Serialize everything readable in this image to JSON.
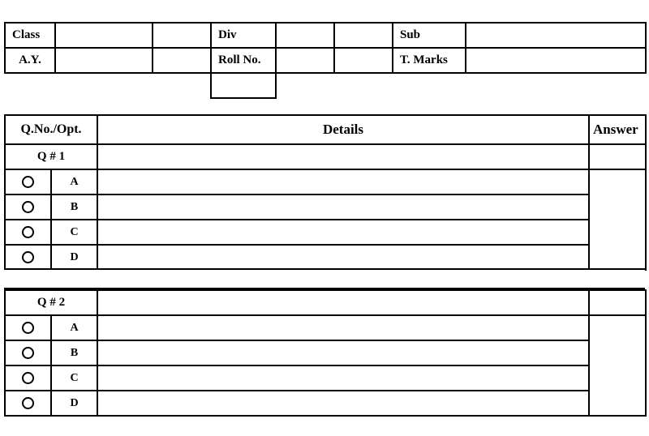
{
  "document": {
    "type": "answer-sheet-form",
    "title": "MCQ Answer Sheet Template"
  },
  "info": {
    "rows": [
      {
        "label_1": "Class",
        "value_1": "",
        "value_1b": "",
        "label_2": "Div",
        "value_2": "",
        "value_2b": "",
        "label_3": "Sub",
        "value_3": ""
      },
      {
        "label_1": "A.Y.",
        "value_1": "",
        "value_1b": "",
        "label_2": "Roll No.",
        "value_2": "",
        "value_2b": "",
        "label_3": "T. Marks",
        "value_3": ""
      }
    ],
    "third_row": {
      "cell": ""
    }
  },
  "grid": {
    "headers": {
      "qno_opt": "Q.No./Opt.",
      "details": "Details",
      "answer": "Answer"
    },
    "questions": [
      {
        "number_label": "Q # 1",
        "question_details": "",
        "answer": "",
        "options": [
          {
            "bubble": "radio-circle-icon",
            "letter": "A",
            "details": ""
          },
          {
            "bubble": "radio-circle-icon",
            "letter": "B",
            "details": ""
          },
          {
            "bubble": "radio-circle-icon",
            "letter": "C",
            "details": ""
          },
          {
            "bubble": "radio-circle-icon",
            "letter": "D",
            "details": ""
          }
        ]
      },
      {
        "number_label": "Q # 2",
        "question_details": "",
        "answer": "",
        "options": [
          {
            "bubble": "radio-circle-icon",
            "letter": "A",
            "details": ""
          },
          {
            "bubble": "radio-circle-icon",
            "letter": "B",
            "details": ""
          },
          {
            "bubble": "radio-circle-icon",
            "letter": "C",
            "details": ""
          },
          {
            "bubble": "radio-circle-icon",
            "letter": "D",
            "details": ""
          }
        ]
      }
    ]
  },
  "colors": {
    "border": "#000000",
    "background": "#ffffff",
    "text": "#000000"
  }
}
